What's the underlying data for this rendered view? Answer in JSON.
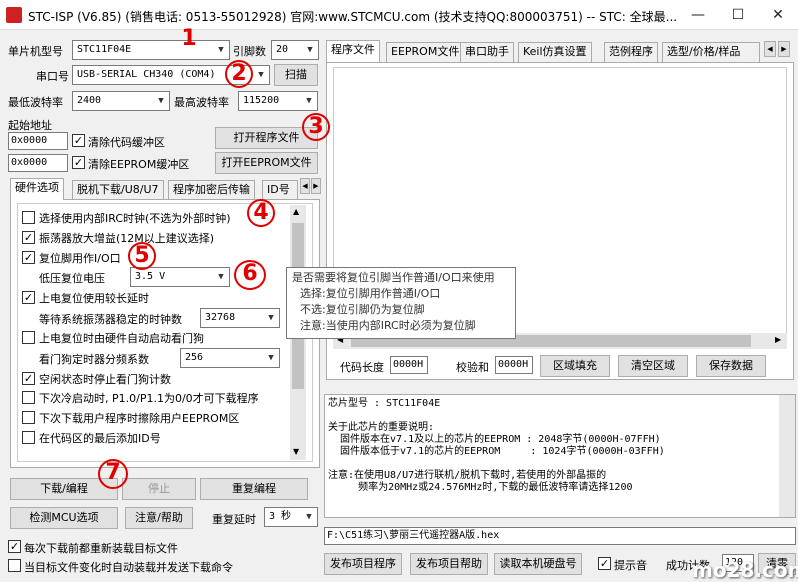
{
  "title": "STC-ISP (V6.85) (销售电话: 0513-55012928) 官网:www.STCMCU.com  (技术支持QQ:800003751)  -- STC: 全球最...",
  "left": {
    "mcu_label": "单片机型号",
    "mcu_value": "STC11F04E",
    "pins_label": "引脚数",
    "pins_value": "20",
    "port_label": "串口号",
    "port_value": "USB-SERIAL CH340 (COM4)",
    "scan_btn": "扫描",
    "min_baud_label": "最低波特率",
    "min_baud_value": "2400",
    "max_baud_label": "最高波特率",
    "max_baud_value": "115200",
    "start_addr_label": "起始地址",
    "addr1": "0x0000",
    "clear_code": "清除代码缓冲区",
    "open_prog": "打开程序文件",
    "addr2": "0x0000",
    "clear_eeprom": "清除EEPROM缓冲区",
    "open_eeprom": "打开EEPROM文件",
    "tabs": [
      "硬件选项",
      "脱机下载/U8/U7",
      "程序加密后传输",
      "ID号"
    ],
    "options": [
      {
        "label": "选择使用内部IRC时钟(不选为外部时钟)",
        "checked": false
      },
      {
        "label": "振荡器放大增益(12M以上建议选择)",
        "checked": true
      },
      {
        "label": "复位脚用作I/O口",
        "checked": true
      },
      {
        "label": "上电复位使用较长延时",
        "checked": true
      },
      {
        "label": "上电复位时由硬件自动启动看门狗",
        "checked": false
      },
      {
        "label": "空闲状态时停止看门狗计数",
        "checked": true
      },
      {
        "label": "下次冷启动时, P1.0/P1.1为0/0才可下载程序",
        "checked": false
      },
      {
        "label": "下次下载用户程序时擦除用户EEPROM区",
        "checked": false
      },
      {
        "label": "在代码区的最后添加ID号",
        "checked": false
      }
    ],
    "low_volt_label": "低压复位电压",
    "low_volt_value": "3.5 V",
    "osc_wait_label": "等待系统振荡器稳定的时钟数",
    "osc_wait_value": "32768",
    "wdt_div_label": "看门狗定时器分频系数",
    "wdt_div_value": "256",
    "download_btn": "下载/编程",
    "stop_btn": "停止",
    "reprogram_btn": "重复编程",
    "detect_btn": "检测MCU选项",
    "help_btn": "注意/帮助",
    "repeat_delay_label": "重复延时",
    "repeat_delay_value": "3 秒",
    "reload_before": "每次下载前都重新装载目标文件",
    "auto_reload": "当目标文件变化时自动装载并发送下载命令"
  },
  "right": {
    "tabs": [
      "程序文件",
      "EEPROM文件",
      "串口助手",
      "Keil仿真设置",
      "范例程序",
      "选型/价格/样品"
    ],
    "code_len_label": "代码长度",
    "code_len_value": "0000H",
    "checksum_label": "校验和",
    "checksum_value": "0000H",
    "fill_btn": "区域填充",
    "clear_btn": "清空区域",
    "save_btn": "保存数据",
    "info_lines": "芯片型号 : STC11F04E\n\n关于此芯片的重要说明:\n  固件版本在v7.1及以上的芯片的EEPROM : 2048字节(0000H-07FFH)\n  固件版本低于v7.1的芯片的EEPROM     : 1024字节(0000H-03FFH)\n\n注意:在使用U8/U7进行联机/脱机下载时,若使用的外部晶振的\n     频率为20MHz或24.576MHz时,下载的最低波特率请选择1200",
    "file_path": "F:\\C51练习\\萝丽三代遥控器A版.hex",
    "publish_btn": "发布项目程序",
    "publish_help_btn": "发布项目帮助",
    "read_disk_btn": "读取本机硬盘号",
    "beep_label": "提示音",
    "success_label": "成功计数",
    "success_value": "120",
    "clear_count_btn": "清零"
  },
  "tooltip": {
    "line1": "是否需要将复位引脚当作普通I/O口来使用",
    "line2": "选择:复位引脚用作普通I/O口",
    "line3": "不选:复位引脚仍为复位脚",
    "line4": "注意:当使用内部IRC时必须为复位脚"
  },
  "annotations": [
    "1",
    "2",
    "3",
    "4",
    "5",
    "6",
    "7"
  ],
  "watermark": "mo28.com"
}
